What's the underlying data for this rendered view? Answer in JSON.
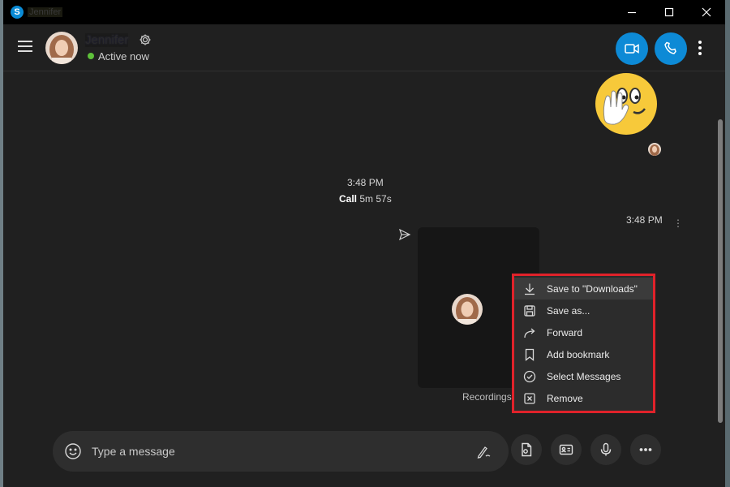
{
  "titlebar": {
    "app_icon_letter": "S",
    "title": "Jennifer"
  },
  "header": {
    "contact_name": "Jennifer",
    "status_text": "Active now",
    "status_color": "#5ec13a",
    "accent_color": "#0d8ad6"
  },
  "chat": {
    "call_time": "3:48 PM",
    "call_label": "Call",
    "call_duration": "5m 57s",
    "recording_time": "3:48 PM",
    "recording_label": "Recordings"
  },
  "context_menu": {
    "highlight_color": "#e0222a",
    "items": [
      {
        "label": "Save to \"Downloads\"",
        "icon": "download-icon"
      },
      {
        "label": "Save as...",
        "icon": "save-icon"
      },
      {
        "label": "Forward",
        "icon": "forward-icon"
      },
      {
        "label": "Add bookmark",
        "icon": "bookmark-icon"
      },
      {
        "label": "Select Messages",
        "icon": "check-circle-icon"
      },
      {
        "label": "Remove",
        "icon": "remove-icon"
      }
    ]
  },
  "composer": {
    "placeholder": "Type a message"
  }
}
